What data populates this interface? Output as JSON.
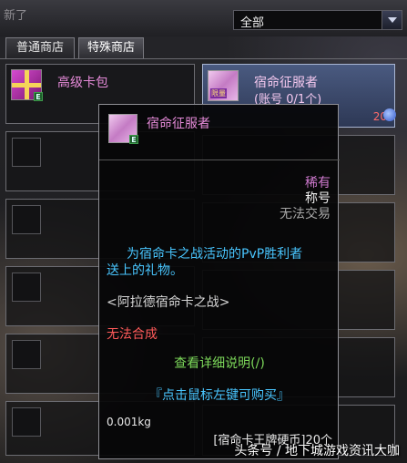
{
  "header": {
    "ghost_label": "新了",
    "filter_value": "全部"
  },
  "tabs": [
    {
      "label": "普通商店",
      "active": false
    },
    {
      "label": "特殊商店",
      "active": true
    }
  ],
  "items": [
    {
      "name": "高级卡包"
    },
    {
      "name": "宿命征服者",
      "sub": "(账号 0/1个)",
      "price": "20"
    }
  ],
  "tooltip": {
    "title": "宿命征服者",
    "rarity": "稀有",
    "category": "称号",
    "trade": "无法交易",
    "desc_line1": "为宿命卡之战活动的PvP胜利者",
    "desc_line2": "送上的礼物。",
    "origin": "<阿拉德宿命卡之战>",
    "no_combine": "无法合成",
    "detail_link": "查看详细说明(/)",
    "buy_hint": "『点击鼠标左键可购买』",
    "weight": "0.001kg",
    "cost": "[宿命卡王牌硬币]20个"
  },
  "watermark": "头条号 / 地下城游戏资讯大咖",
  "colors": {
    "rare_pink": "#e58ad8",
    "info_blue": "#49c6ff",
    "warn_red": "#ff5a5a",
    "link_green": "#7cd85a"
  }
}
